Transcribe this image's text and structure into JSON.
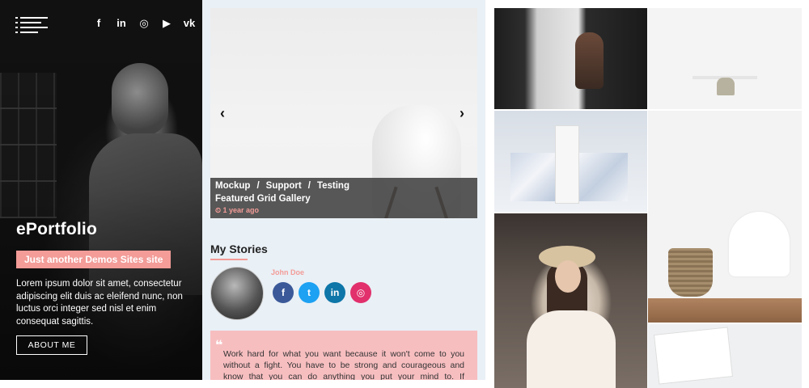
{
  "sidebar": {
    "social": [
      "f",
      "in",
      "◎",
      "▶",
      "vk"
    ],
    "brand": "ePortfolio",
    "tagline": "Just another Demos Sites site",
    "bio": "Lorem ipsum dolor sit amet, consectetur adipiscing elit duis ac eleifend nunc, non luctus orci integer sed nisl et enim consequat sagittis.",
    "about_label": "ABOUT ME"
  },
  "slider": {
    "prev": "‹",
    "next": "›",
    "categories": [
      "Mockup",
      "Support",
      "Testing"
    ],
    "separator": "/",
    "title": "Featured Grid Gallery",
    "time": "⏲ 1 year ago"
  },
  "stories": {
    "heading": "My Stories",
    "author": "John Doe",
    "social": [
      {
        "label": "f",
        "color": "#3b5998"
      },
      {
        "label": "t",
        "color": "#1da1f2"
      },
      {
        "label": "in",
        "color": "#0e76a8"
      },
      {
        "label": "◎",
        "color": "#e1306c"
      }
    ],
    "quote_mark": "❝",
    "quote": "Work hard for what you want because it won't come to you without a fight. You have to be strong and courageous and know that you can do anything you put your mind to. If somebody puts"
  },
  "colors": {
    "accent": "#f39c98",
    "mid_bg": "#e9f0f6",
    "quote_bg": "#f7bec0"
  }
}
